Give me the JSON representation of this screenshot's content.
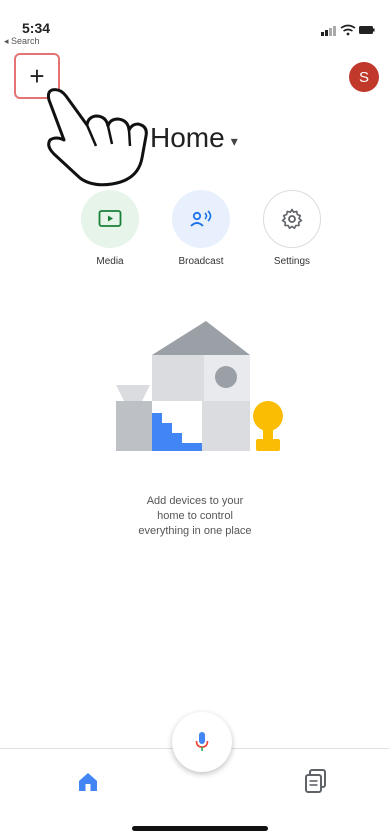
{
  "status_bar": {
    "time": "5:34",
    "back_label": "◂ Search"
  },
  "header": {
    "add_symbol": "+",
    "avatar_initial": "S",
    "title": "Home",
    "title_chevron": "▾"
  },
  "actions": [
    {
      "label": "Media",
      "icon": "media-icon",
      "color": "#e6f4ea"
    },
    {
      "label": "Broadcast",
      "icon": "broadcast-icon",
      "color": "#e8f0fe"
    },
    {
      "label": "Settings",
      "icon": "gear-icon",
      "color": "#ffffff"
    }
  ],
  "empty_state": {
    "line1": "Add devices to your",
    "line2": "home to control",
    "line3": "everything in one place"
  },
  "colors": {
    "accent_blue": "#4285f4",
    "avatar_red": "#c0392b",
    "highlight_border": "#e57373",
    "yellow": "#fbbc04"
  }
}
